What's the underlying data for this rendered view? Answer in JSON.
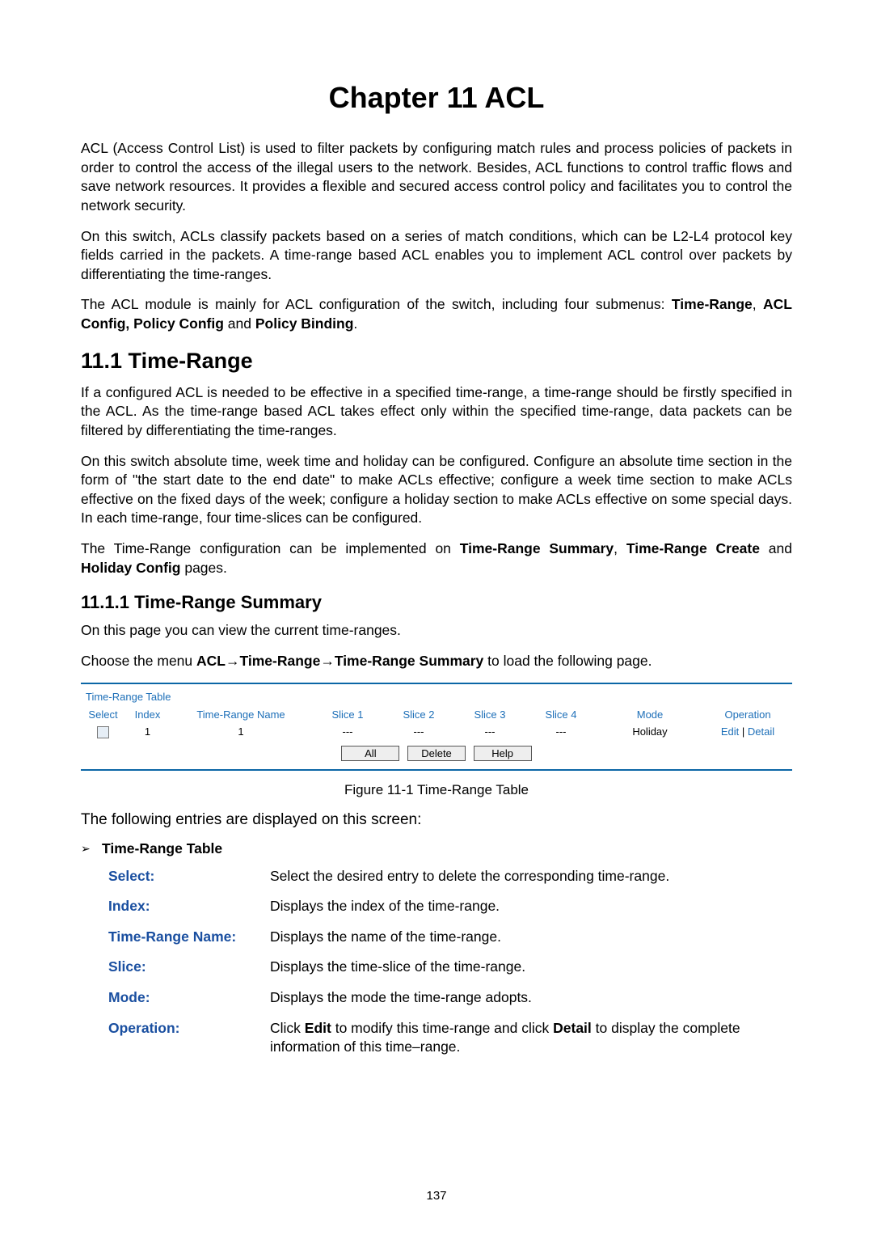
{
  "chapter_title": "Chapter 11  ACL",
  "paragraphs": {
    "p1": "ACL (Access Control List) is used to filter packets by configuring match rules and process policies of packets in order to control the access of the illegal users to the network. Besides, ACL functions to control traffic flows and save network resources. It provides a flexible and secured access control policy and facilitates you to control the network security.",
    "p2": "On this switch, ACLs classify packets based on a series of match conditions, which can be L2-L4 protocol key fields carried in the packets. A time-range based ACL enables you to implement ACL control over packets by differentiating the time-ranges.",
    "p3a": "The ACL module is mainly for ACL configuration of the switch, including four submenus: ",
    "p3b_bold": "Time-Range",
    "p3c": ", ",
    "p3d_bold": "ACL Config, Policy Config",
    "p3e": " and ",
    "p3f_bold": "Policy Binding",
    "p3g": "."
  },
  "section_11_1": "11.1 Time-Range",
  "tr_paras": {
    "p1": "If a configured ACL is needed to be effective in a specified time-range, a time-range should be firstly specified in the ACL. As the time-range based ACL takes effect only within the specified time-range, data packets can be filtered by differentiating the time-ranges.",
    "p2": "On this switch absolute time, week time and holiday can be configured. Configure an absolute time section in the form of \"the start date to the end date\" to make ACLs effective; configure a week time section to make ACLs effective on the fixed days of the week; configure a holiday section to make ACLs effective on some special days. In each time-range, four time-slices can be configured.",
    "p3a": "The Time-Range configuration can be implemented on ",
    "p3b_bold": "Time-Range Summary",
    "p3c": ", ",
    "p3d_bold": "Time-Range Create",
    "p3e": " and ",
    "p3f_bold": "Holiday Config",
    "p3g": " pages."
  },
  "subsection_11_1_1": "11.1.1  Time-Range Summary",
  "summary_paras": {
    "p1": "On this page you can view the current time-ranges.",
    "p2a": "Choose the menu ",
    "p2b_bold": "ACL→Time-Range→Time-Range Summary",
    "p2c": " to load the following page."
  },
  "table": {
    "title": "Time-Range Table",
    "headers": {
      "select": "Select",
      "index": "Index",
      "name": "Time-Range Name",
      "slice1": "Slice 1",
      "slice2": "Slice 2",
      "slice3": "Slice 3",
      "slice4": "Slice 4",
      "mode": "Mode",
      "operation": "Operation"
    },
    "row": {
      "index": "1",
      "name": "1",
      "slice1": "---",
      "slice2": "---",
      "slice3": "---",
      "slice4": "---",
      "mode": "Holiday",
      "op_edit": "Edit",
      "op_sep": " | ",
      "op_detail": "Detail"
    },
    "buttons": {
      "all": "All",
      "delete": "Delete",
      "help": "Help"
    }
  },
  "figure_caption": "Figure 11-1 Time-Range Table",
  "entries_intro": "The following entries are displayed on this screen:",
  "bullet_marker": "➢",
  "bullet_label": "Time-Range Table",
  "definitions": [
    {
      "term": "Select:",
      "desc_plain": "Select the desired entry to delete the corresponding time-range."
    },
    {
      "term": "Index:",
      "desc_plain": "Displays the index of the time-range."
    },
    {
      "term": "Time-Range Name:",
      "desc_plain": "Displays the name of the time-range."
    },
    {
      "term": "Slice:",
      "desc_plain": "Displays the time-slice of the time-range."
    },
    {
      "term": "Mode:",
      "desc_plain": "Displays the mode the time-range adopts."
    }
  ],
  "def_operation": {
    "term": "Operation:",
    "a": "Click ",
    "b_bold": "Edit",
    "c": " to modify this time-range and click ",
    "d_bold": "Detail",
    "e": " to display the complete information of this time–range."
  },
  "page_number": "137"
}
